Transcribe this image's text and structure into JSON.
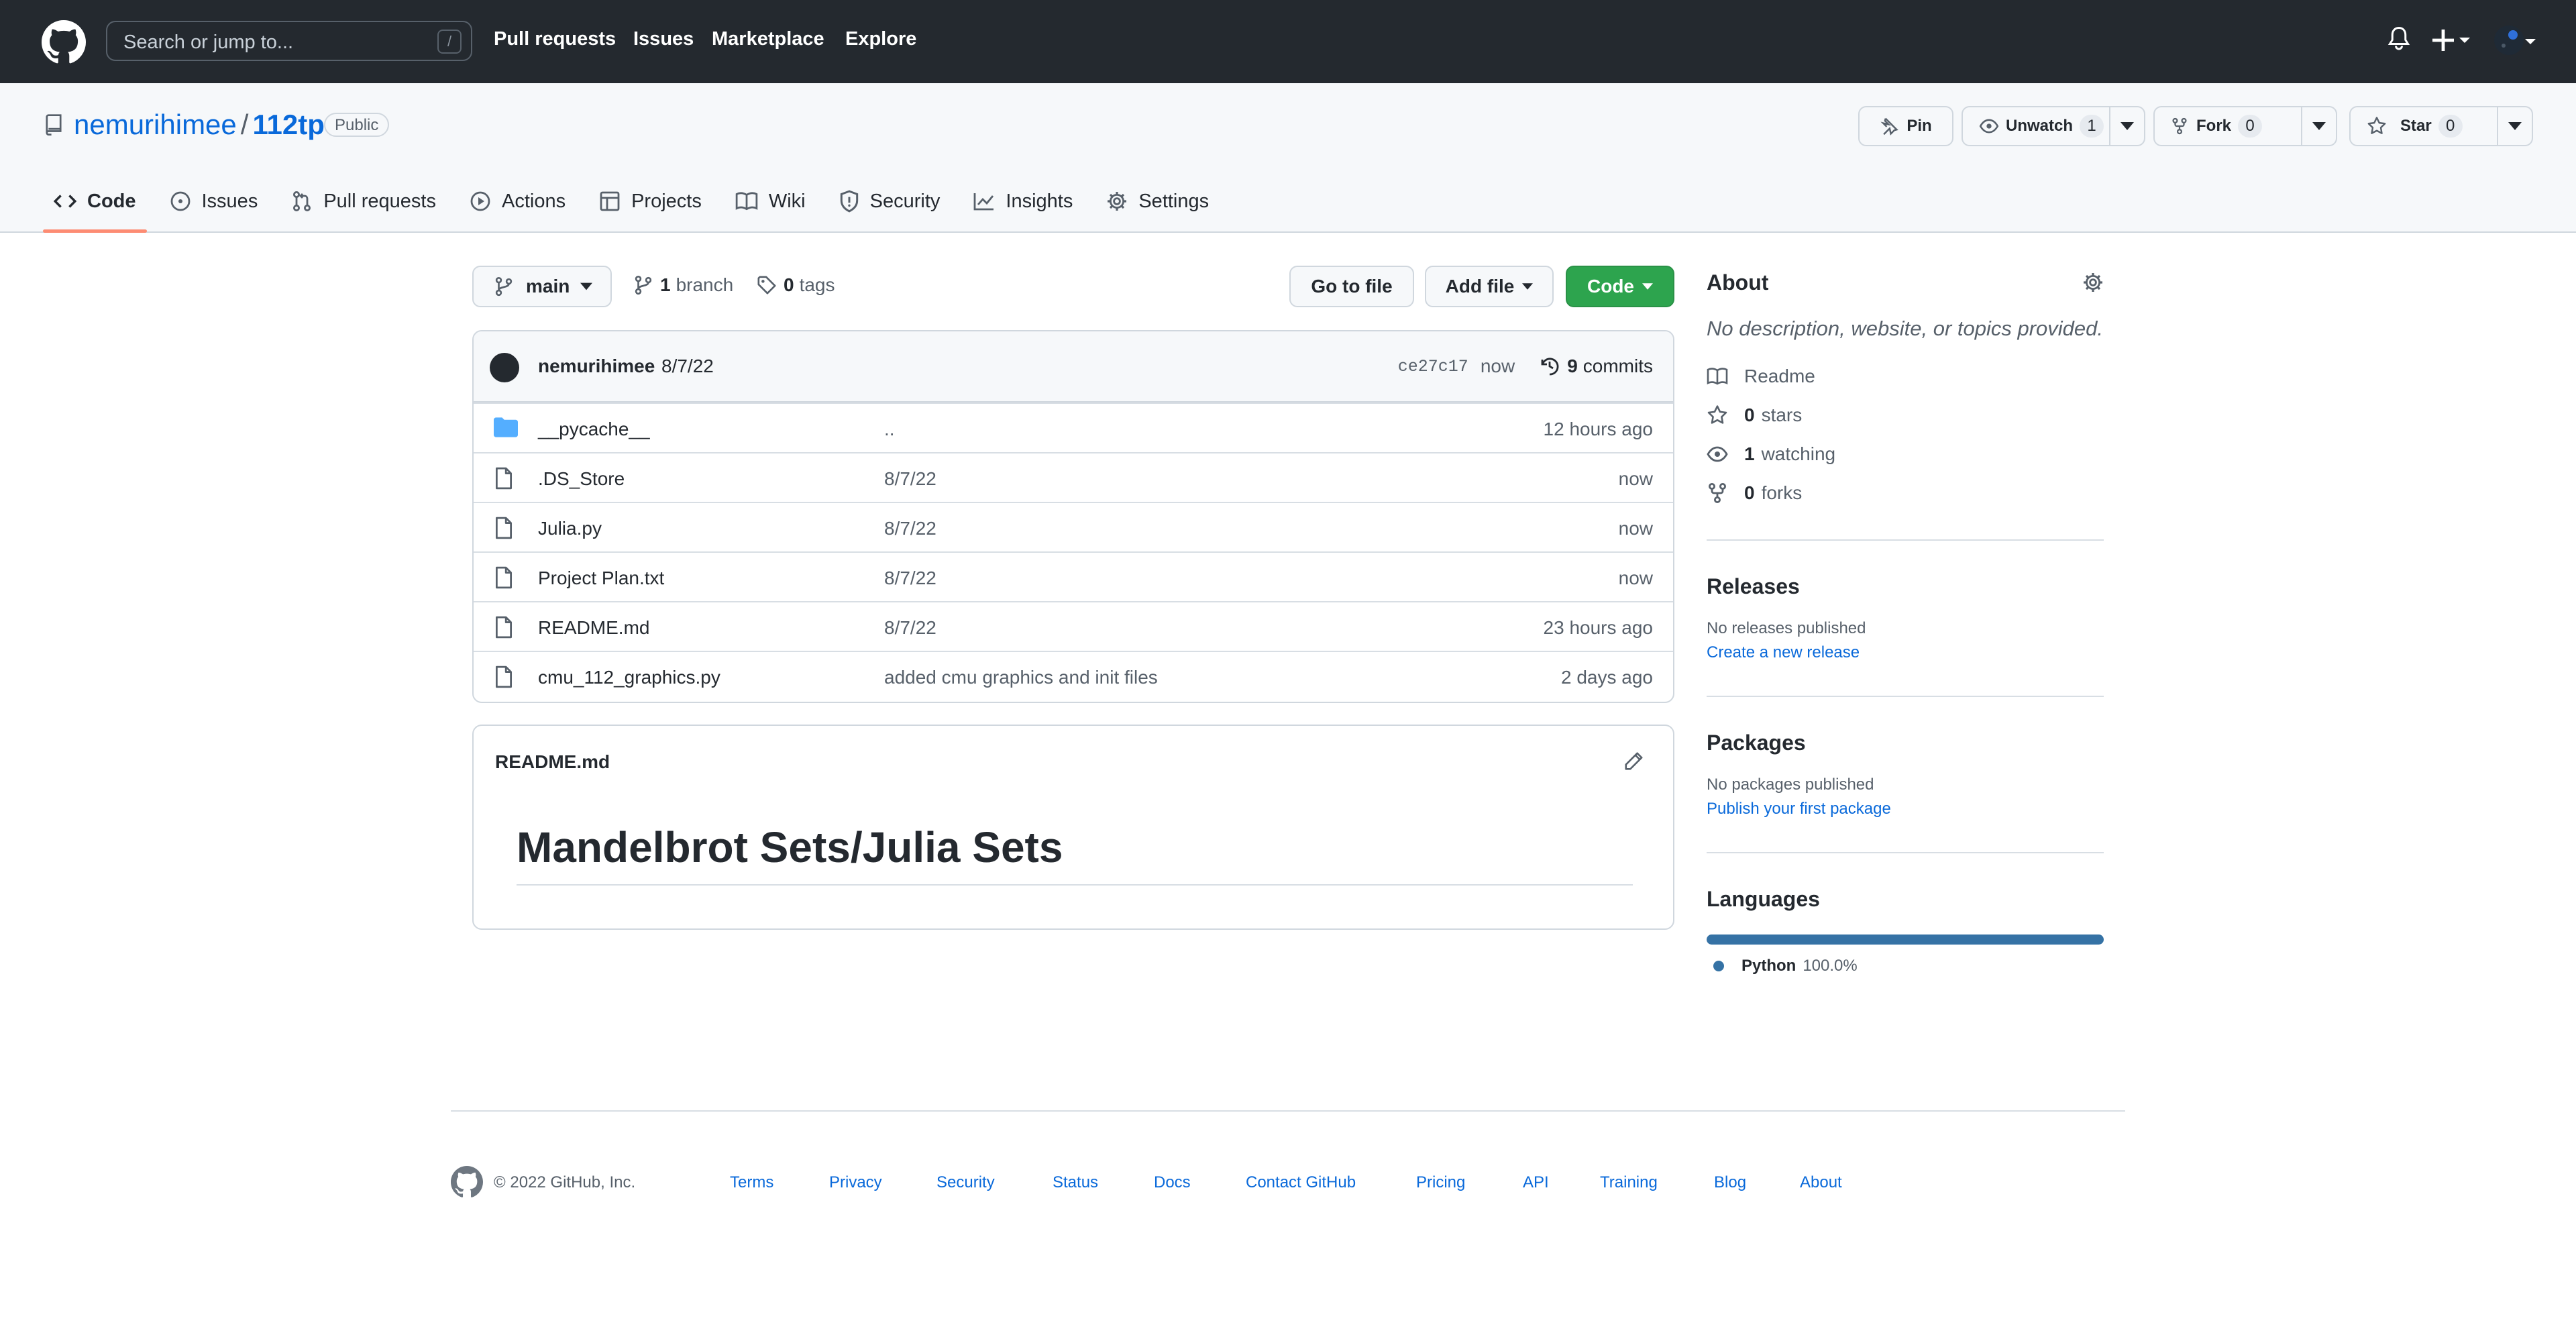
{
  "header": {
    "search_placeholder": "Search or jump to...",
    "search_shortcut": "/",
    "nav": [
      "Pull requests",
      "Issues",
      "Marketplace",
      "Explore"
    ]
  },
  "repo": {
    "owner": "nemurihimee",
    "name": "112tp",
    "visibility": "Public",
    "pin_label": "Pin",
    "unwatch_label": "Unwatch",
    "watch_count": "1",
    "fork_label": "Fork",
    "fork_count": "0",
    "star_label": "Star",
    "star_count": "0"
  },
  "tabs": [
    "Code",
    "Issues",
    "Pull requests",
    "Actions",
    "Projects",
    "Wiki",
    "Security",
    "Insights",
    "Settings"
  ],
  "toolbar": {
    "branch": "main",
    "branch_count": "1",
    "branch_word": "branch",
    "tag_count": "0",
    "tag_word": "tags",
    "go_to_file": "Go to file",
    "add_file": "Add file",
    "code": "Code"
  },
  "commit": {
    "author": "nemurihimee",
    "message": "8/7/22",
    "sha": "ce27c17",
    "time": "now",
    "count": "9",
    "count_word": "commits"
  },
  "files": [
    {
      "name": "__pycache__",
      "message": "..",
      "age": "12 hours ago",
      "type": "folder"
    },
    {
      "name": ".DS_Store",
      "message": "8/7/22",
      "age": "now",
      "type": "file"
    },
    {
      "name": "Julia.py",
      "message": "8/7/22",
      "age": "now",
      "type": "file"
    },
    {
      "name": "Project Plan.txt",
      "message": "8/7/22",
      "age": "now",
      "type": "file"
    },
    {
      "name": "README.md",
      "message": "8/7/22",
      "age": "23 hours ago",
      "type": "file"
    },
    {
      "name": "cmu_112_graphics.py",
      "message": "added cmu graphics and init files",
      "age": "2 days ago",
      "type": "file"
    }
  ],
  "readme": {
    "filename": "README.md",
    "heading": "Mandelbrot Sets/Julia Sets"
  },
  "about": {
    "title": "About",
    "description": "No description, website, or topics provided.",
    "readme": "Readme",
    "stars_count": "0",
    "stars_word": "stars",
    "watching_count": "1",
    "watching_word": "watching",
    "forks_count": "0",
    "forks_word": "forks"
  },
  "releases": {
    "title": "Releases",
    "text": "No releases published",
    "link": "Create a new release"
  },
  "packages": {
    "title": "Packages",
    "text": "No packages published",
    "link": "Publish your first package"
  },
  "languages": {
    "title": "Languages",
    "name": "Python",
    "percent": "100.0%",
    "color": "#3572A5"
  },
  "footer": {
    "copyright": "© 2022 GitHub, Inc.",
    "links": [
      "Terms",
      "Privacy",
      "Security",
      "Status",
      "Docs",
      "Contact GitHub",
      "Pricing",
      "API",
      "Training",
      "Blog",
      "About"
    ]
  }
}
